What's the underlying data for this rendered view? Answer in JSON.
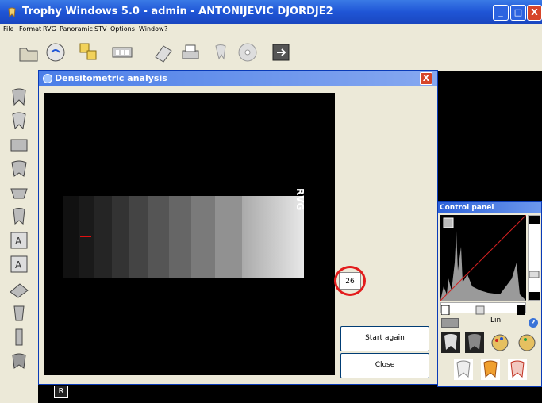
{
  "window": {
    "title": "Trophy Windows 5.0 - admin - ANTONIJEVIC DJORDJE2",
    "min_glyph": "_",
    "max_glyph": "□",
    "close_glyph": "X"
  },
  "menu": {
    "items": [
      "File",
      "Format",
      "RVG",
      "Panoramic",
      "STV",
      "Options",
      "Window",
      "?"
    ]
  },
  "dialog": {
    "title": "Densitometric analysis",
    "close_glyph": "X",
    "image_label": "RVG",
    "measured_value": "26",
    "start_again_label": "Start again",
    "close_label": "Close"
  },
  "control_panel": {
    "title": "Control panel",
    "mode_label": "Lin",
    "help_glyph": "?"
  },
  "footer": {
    "r_label": "R"
  },
  "colors": {
    "xp_blue": "#1f55d6",
    "dialog_bg": "#ece9d8",
    "highlight_circle": "#e31c1c"
  },
  "icons": [
    "folder-open-icon",
    "scanner-icon",
    "layout-icon",
    "filmstrip-icon",
    "sensor-icon",
    "print-icon",
    "tooth-tool-icon",
    "disc-icon",
    "exit-icon"
  ]
}
